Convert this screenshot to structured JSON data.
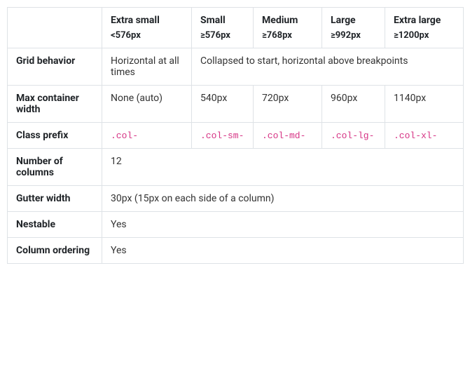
{
  "headers": {
    "xs": {
      "label": "Extra small",
      "sub": "<576px"
    },
    "sm": {
      "label": "Small",
      "sub": "≥576px"
    },
    "md": {
      "label": "Medium",
      "sub": "≥768px"
    },
    "lg": {
      "label": "Large",
      "sub": "≥992px"
    },
    "xl": {
      "label": "Extra large",
      "sub": "≥1200px"
    }
  },
  "rows": {
    "gridBehavior": {
      "label": "Grid behavior",
      "xs": "Horizontal at all times",
      "rest": "Collapsed to start, horizontal above breakpoints"
    },
    "maxWidth": {
      "label": "Max container width",
      "xs": "None (auto)",
      "sm": "540px",
      "md": "720px",
      "lg": "960px",
      "xl": "1140px"
    },
    "classPrefix": {
      "label": "Class prefix",
      "xs": ".col-",
      "sm": ".col-sm-",
      "md": ".col-md-",
      "lg": ".col-lg-",
      "xl": ".col-xl-"
    },
    "numColumns": {
      "label": "Number of columns",
      "value": "12"
    },
    "gutterWidth": {
      "label": "Gutter width",
      "value": "30px (15px on each side of a column)"
    },
    "nestable": {
      "label": "Nestable",
      "value": "Yes"
    },
    "columnOrdering": {
      "label": "Column ordering",
      "value": "Yes"
    }
  }
}
